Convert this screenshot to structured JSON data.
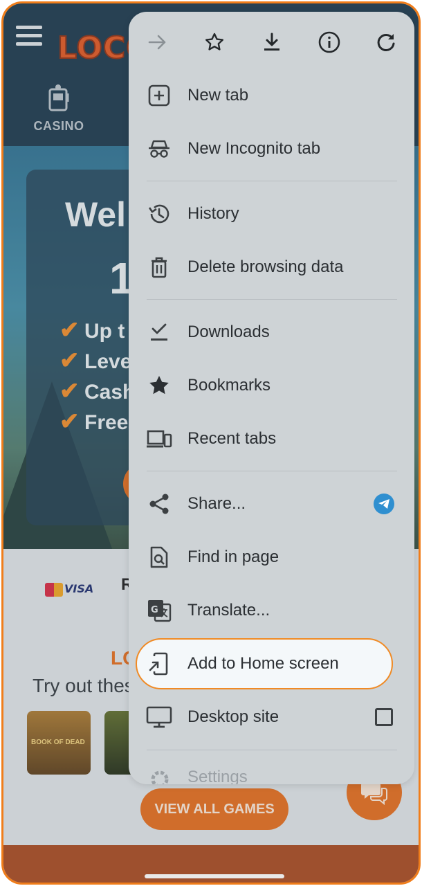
{
  "site": {
    "logo_text": "LOCO",
    "nav": {
      "casino_label": "CASINO"
    },
    "hero": {
      "title_fragment": "Wel",
      "big_fragment": "1",
      "perks": [
        "Up t",
        "Leve",
        "Cash",
        "Free"
      ]
    },
    "payments": {
      "visa_label": "VISA",
      "second_label": "R"
    },
    "games": {
      "title_fragment": "LO",
      "subtitle_fragment": "Try out thes",
      "thumb1_text": "BOOK OF DEAD",
      "view_all_label": "VIEW ALL GAMES"
    }
  },
  "browser_menu": {
    "toolbar": [
      "forward-icon",
      "bookmark-star-icon",
      "download-icon",
      "info-icon",
      "reload-icon"
    ],
    "items": [
      {
        "label": "New tab",
        "icon": "new-tab-icon"
      },
      {
        "label": "New Incognito tab",
        "icon": "incognito-icon"
      },
      {
        "label": "History",
        "icon": "history-icon"
      },
      {
        "label": "Delete browsing data",
        "icon": "trash-icon"
      },
      {
        "label": "Downloads",
        "icon": "downloads-icon"
      },
      {
        "label": "Bookmarks",
        "icon": "star-icon"
      },
      {
        "label": "Recent tabs",
        "icon": "devices-icon"
      },
      {
        "label": "Share...",
        "icon": "share-icon"
      },
      {
        "label": "Find in page",
        "icon": "find-icon"
      },
      {
        "label": "Translate...",
        "icon": "translate-icon"
      },
      {
        "label": "Add to Home screen",
        "icon": "add-home-icon"
      },
      {
        "label": "Desktop site",
        "icon": "monitor-icon"
      },
      {
        "label": "Settings",
        "icon": "settings-icon"
      }
    ],
    "highlighted_item": "Add to Home screen",
    "desktop_site_checked": false
  },
  "colors": {
    "accent_orange": "#f08a24",
    "menu_bg": "#ced3d6",
    "header_bg": "#173447"
  }
}
